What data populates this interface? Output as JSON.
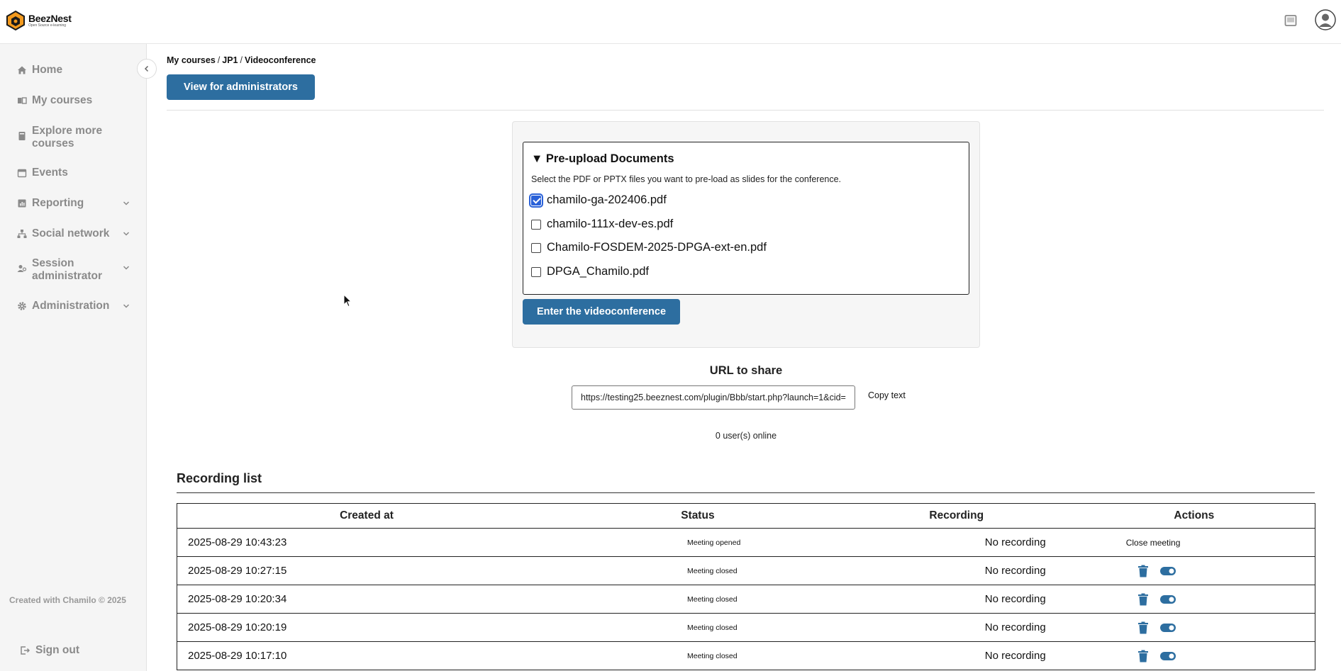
{
  "header": {
    "brand_name": "BeezNest",
    "brand_tagline": "Open Source e-learning",
    "icons": [
      "inbox-icon",
      "user-avatar-icon"
    ]
  },
  "sidebar": {
    "items": [
      {
        "label": "Home",
        "icon": "home-icon",
        "expandable": false
      },
      {
        "label": "My courses",
        "icon": "courses-icon",
        "expandable": false
      },
      {
        "label": "Explore more courses",
        "icon": "catalog-icon",
        "expandable": false
      },
      {
        "label": "Events",
        "icon": "calendar-icon",
        "expandable": false
      },
      {
        "label": "Reporting",
        "icon": "chart-icon",
        "expandable": true
      },
      {
        "label": "Social network",
        "icon": "network-icon",
        "expandable": true
      },
      {
        "label": "Session administrator",
        "icon": "users-icon",
        "expandable": true
      },
      {
        "label": "Administration",
        "icon": "gear-icon",
        "expandable": true
      }
    ],
    "footer_note": "Created with Chamilo © 2025",
    "sign_out": "Sign out"
  },
  "breadcrumb": [
    "My courses",
    "JP1",
    "Videoconference"
  ],
  "admin_button": "View for administrators",
  "preupload": {
    "legend": "Pre-upload Documents",
    "hint": "Select the PDF or PPTX files you want to pre-load as slides for the conference.",
    "files": [
      {
        "name": "chamilo-ga-202406.pdf",
        "checked": true
      },
      {
        "name": "chamilo-111x-dev-es.pdf",
        "checked": false
      },
      {
        "name": "Chamilo-FOSDEM-2025-DPGA-ext-en.pdf",
        "checked": false
      },
      {
        "name": "DPGA_Chamilo.pdf",
        "checked": false
      }
    ],
    "enter_button": "Enter the videoconference"
  },
  "share": {
    "title": "URL to share",
    "url": "https://testing25.beeznest.com/plugin/Bbb/start.php?launch=1&cid=",
    "copy_label": "Copy text",
    "online": "0 user(s) online"
  },
  "recordings": {
    "title": "Recording list",
    "columns": [
      "Created at",
      "Status",
      "Recording",
      "Actions"
    ],
    "rows": [
      {
        "created_at": "2025-08-29 10:43:23",
        "status": "Meeting opened",
        "recording": "No recording",
        "action": "Close meeting"
      },
      {
        "created_at": "2025-08-29 10:27:15",
        "status": "Meeting closed",
        "recording": "No recording",
        "action": ""
      },
      {
        "created_at": "2025-08-29 10:20:34",
        "status": "Meeting closed",
        "recording": "No recording",
        "action": ""
      },
      {
        "created_at": "2025-08-29 10:20:19",
        "status": "Meeting closed",
        "recording": "No recording",
        "action": ""
      },
      {
        "created_at": "2025-08-29 10:17:10",
        "status": "Meeting closed",
        "recording": "No recording",
        "action": ""
      }
    ]
  },
  "colors": {
    "primary": "#2d6ea0",
    "sidebar_bg": "#f5f5f5",
    "sidebar_text": "#8a8a8a",
    "checkbox": "#2a61d8"
  }
}
